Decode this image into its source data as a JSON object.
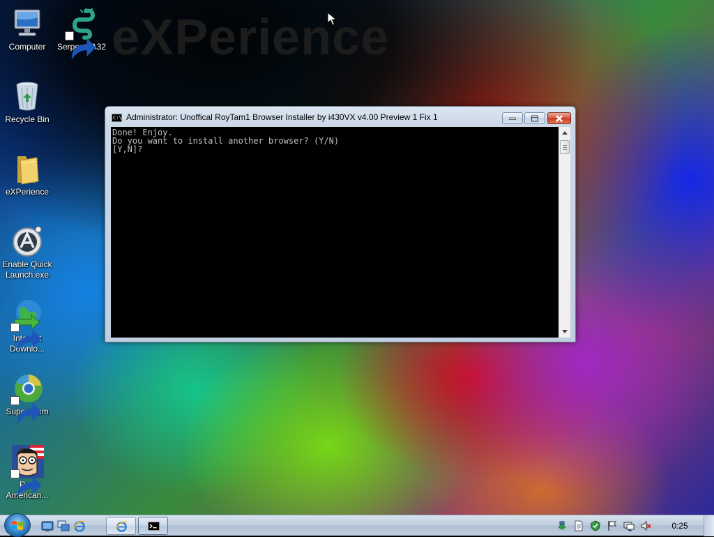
{
  "desktop": {
    "wallpaper_text": "eXPerience",
    "icons": [
      {
        "label": "Computer"
      },
      {
        "label": "Serpent IA32"
      },
      {
        "label": "Recycle Bin"
      },
      {
        "label": "eXPerience"
      },
      {
        "label": "Enable Quick Launch.exe"
      },
      {
        "label": "Internet Downlo..."
      },
      {
        "label": "Supermium"
      },
      {
        "label": "Run American..."
      }
    ]
  },
  "console": {
    "title": "Administrator:  Unoffical RoyTam1 Browser Installer by i430VX v4.00 Preview 1 Fix 1",
    "icon_text": "C:\\",
    "lines": [
      "Done! Enjoy.",
      "Do you want to install another browser? (Y/N)",
      "[Y,N]?"
    ]
  },
  "taskbar": {
    "clock": "0:25",
    "quick_launch": [
      "show-desktop-icon",
      "switch-windows-icon",
      "internet-explorer-icon"
    ],
    "tasks": [
      "internet-explorer-icon",
      "command-prompt-icon"
    ],
    "tray": [
      "network-icon",
      "document-icon",
      "security-icon",
      "flag-icon",
      "monitor-icon",
      "volume-muted-icon"
    ]
  },
  "colors": {
    "console_background": "#000000",
    "console_text": "#c0c0c0",
    "close_button": "#c63a1f",
    "title_bar": "#dce6f2"
  }
}
